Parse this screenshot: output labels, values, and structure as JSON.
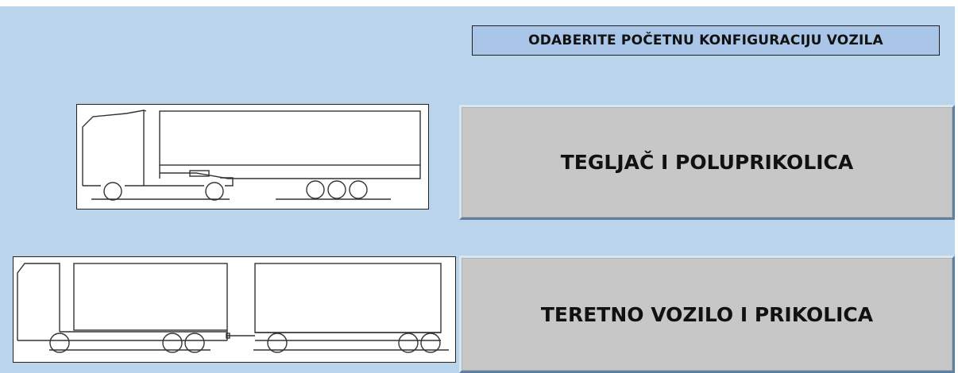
{
  "header": {
    "title": "ODABERITE POČETNU KONFIGURACIJU VOZILA"
  },
  "options": [
    {
      "label": "TEGLJAČ I POLUPRIKOLICA",
      "illustration": "tractor-semitrailer-drawing"
    },
    {
      "label": "TERETNO VOZILO I PRIKOLICA",
      "illustration": "truck-trailer-drawing"
    }
  ],
  "colors": {
    "background": "#bad4ec",
    "header_fill": "#a9c5e8",
    "button_fill": "#c7c7c7",
    "button_border_dark": "#5d7fa1"
  }
}
